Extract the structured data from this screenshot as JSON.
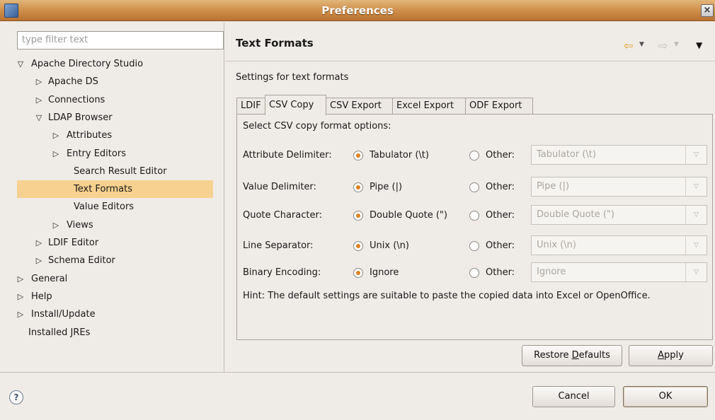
{
  "window": {
    "title": "Preferences",
    "close_glyph": "×"
  },
  "filter": {
    "placeholder": "type filter text"
  },
  "tree": [
    {
      "label": "Apache Directory Studio",
      "arrow": "expanded",
      "level": 0
    },
    {
      "label": "Apache DS",
      "arrow": "collapsed",
      "level": 1
    },
    {
      "label": "Connections",
      "arrow": "collapsed",
      "level": 1
    },
    {
      "label": "LDAP Browser",
      "arrow": "expanded",
      "level": 1
    },
    {
      "label": "Attributes",
      "arrow": "collapsed",
      "level": 2
    },
    {
      "label": "Entry Editors",
      "arrow": "collapsed",
      "level": 2
    },
    {
      "label": "Search Result Editor",
      "arrow": "none",
      "level": 2
    },
    {
      "label": "Text Formats",
      "arrow": "none",
      "level": 2,
      "selected": true
    },
    {
      "label": "Value Editors",
      "arrow": "none",
      "level": 2
    },
    {
      "label": "Views",
      "arrow": "collapsed",
      "level": 2
    },
    {
      "label": "LDIF Editor",
      "arrow": "collapsed",
      "level": 1
    },
    {
      "label": "Schema Editor",
      "arrow": "collapsed",
      "level": 1
    },
    {
      "label": "General",
      "arrow": "collapsed",
      "level": 0
    },
    {
      "label": "Help",
      "arrow": "collapsed",
      "level": 0
    },
    {
      "label": "Install/Update",
      "arrow": "collapsed",
      "level": 0
    },
    {
      "label": "Installed JREs",
      "arrow": "none",
      "level": 0
    }
  ],
  "page": {
    "title": "Text Formats",
    "description": "Settings for text formats",
    "tabs": [
      "LDIF",
      "CSV Copy",
      "CSV Export",
      "Excel Export",
      "ODF Export"
    ],
    "active_tab": "CSV Copy",
    "heading": "Select CSV copy format options:",
    "rows": [
      {
        "label": "Attribute Delimiter:",
        "option": "Tabulator (\\t)",
        "other": "Other:",
        "combo": "Tabulator (\\t)"
      },
      {
        "label": "Value Delimiter:",
        "option": "Pipe (|)",
        "other": "Other:",
        "combo": "Pipe (|)"
      },
      {
        "label": "Quote Character:",
        "option": "Double Quote (\")",
        "other": "Other:",
        "combo": "Double Quote (\")"
      },
      {
        "label": "Line Separator:",
        "option": "Unix (\\n)",
        "other": "Other:",
        "combo": "Unix (\\n)"
      },
      {
        "label": "Binary Encoding:",
        "option": "Ignore",
        "other": "Other:",
        "combo": "Ignore"
      }
    ],
    "hint": "Hint: The default settings are suitable to paste the copied data into Excel or OpenOffice."
  },
  "buttons": {
    "restore_pre": "Restore ",
    "restore_mnemonic": "D",
    "restore_post": "efaults",
    "apply_mnemonic": "A",
    "apply_post": "pply",
    "cancel": "Cancel",
    "ok": "OK",
    "help": "?"
  },
  "icons": {
    "back": "arrow-left-icon",
    "forward": "arrow-right-icon",
    "view_menu": "triangle-down-icon",
    "help": "help-icon"
  },
  "colors": {
    "titlebar": "#cf8f4a",
    "selection": "#f7d18f",
    "radio_dot": "#e0801f",
    "back_arrow": "#e0a120"
  }
}
